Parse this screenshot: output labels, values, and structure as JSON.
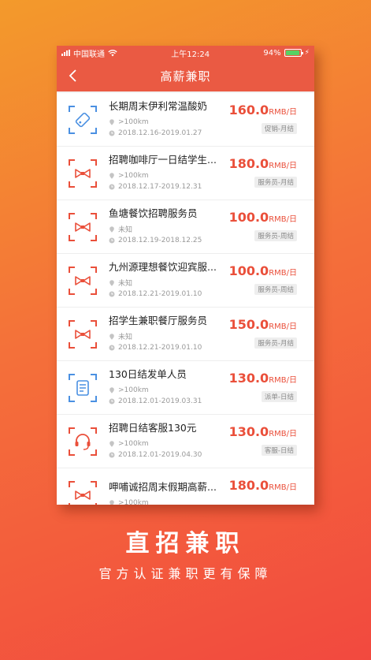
{
  "status_bar": {
    "carrier": "中国联通",
    "time": "上午12:24",
    "battery_percent": "94%",
    "battery_level": 0.94
  },
  "nav": {
    "title": "高薪兼职",
    "back_icon": "chevron-left-icon"
  },
  "jobs": [
    {
      "title": "长期周末伊利常温酸奶",
      "distance": ">100km",
      "date": "2018.12.16-2019.01.27",
      "salary": "160.0",
      "unit": "RMB/日",
      "tag": "促销-月结",
      "icon": "tag-icon",
      "icon_color": "#4a90e2"
    },
    {
      "title": "招聘咖啡厅一日结学生...",
      "distance": ">100km",
      "date": "2018.12.17-2019.12.31",
      "salary": "180.0",
      "unit": "RMB/日",
      "tag": "服务员-月结",
      "icon": "bowtie-icon",
      "icon_color": "#ea4f3a"
    },
    {
      "title": "鱼塘餐饮招聘服务员",
      "distance": "未知",
      "date": "2018.12.19-2018.12.25",
      "salary": "100.0",
      "unit": "RMB/日",
      "tag": "服务员-周结",
      "icon": "bowtie-icon",
      "icon_color": "#ea4f3a"
    },
    {
      "title": "九州源理想餐饮迎宾服...",
      "distance": "未知",
      "date": "2018.12.21-2019.01.10",
      "salary": "100.0",
      "unit": "RMB/日",
      "tag": "服务员-周结",
      "icon": "bowtie-icon",
      "icon_color": "#ea4f3a"
    },
    {
      "title": "招学生兼职餐厅服务员",
      "distance": "未知",
      "date": "2018.12.21-2019.01.10",
      "salary": "150.0",
      "unit": "RMB/日",
      "tag": "服务员-月结",
      "icon": "bowtie-icon",
      "icon_color": "#ea4f3a"
    },
    {
      "title": "130日结发单人员",
      "distance": ">100km",
      "date": "2018.12.01-2019.03.31",
      "salary": "130.0",
      "unit": "RMB/日",
      "tag": "派单-日结",
      "icon": "flyer-icon",
      "icon_color": "#4a90e2"
    },
    {
      "title": "招聘日结客服130元",
      "distance": ">100km",
      "date": "2018.12.01-2019.04.30",
      "salary": "130.0",
      "unit": "RMB/日",
      "tag": "客服-日结",
      "icon": "headset-icon",
      "icon_color": "#ea4f3a"
    },
    {
      "title": "呷哺诚招周末假期高薪...",
      "distance": ">100km",
      "date": "",
      "salary": "180.0",
      "unit": "RMB/日",
      "tag": "",
      "icon": "bowtie-icon",
      "icon_color": "#ea4f3a"
    }
  ],
  "promo": {
    "headline": "直招兼职",
    "subline": "官方认证兼职更有保障"
  },
  "colors": {
    "accent": "#ea5a43",
    "salary": "#ea4f3a",
    "blue_icon": "#4a90e2"
  }
}
